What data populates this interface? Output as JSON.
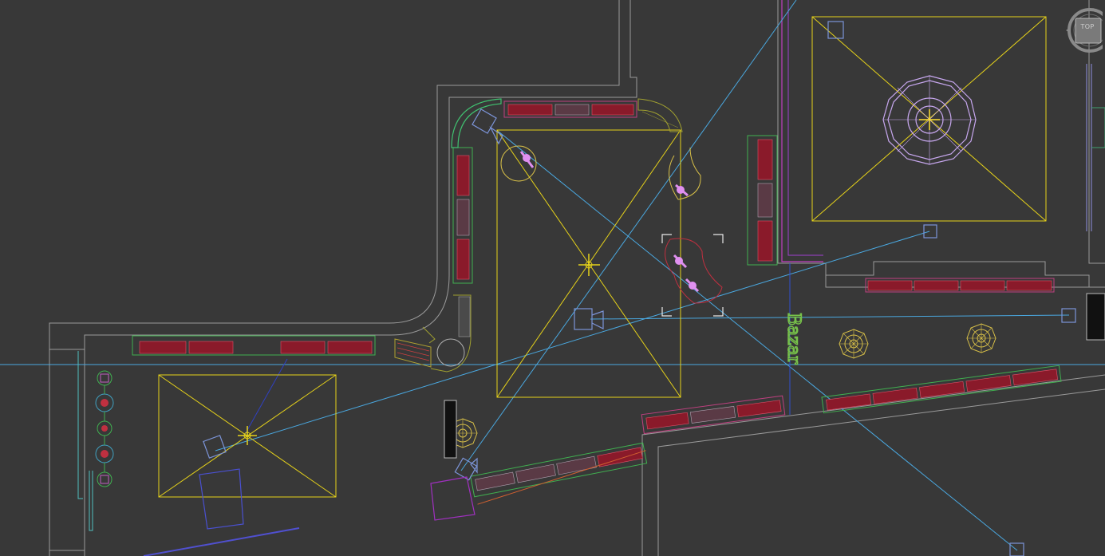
{
  "viewcube": {
    "label": "TOP"
  },
  "plan": {
    "sign_text": "Bazar"
  }
}
